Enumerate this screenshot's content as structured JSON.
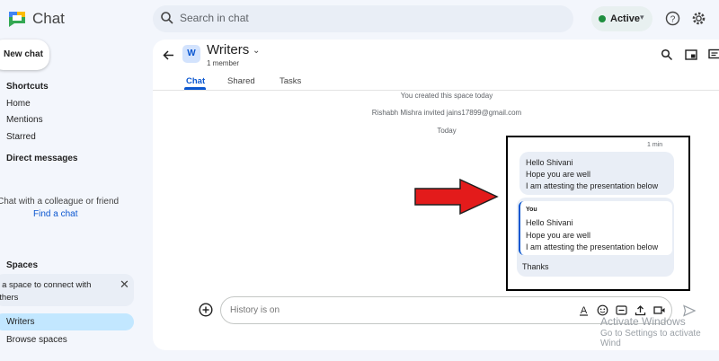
{
  "app": {
    "title": "Chat"
  },
  "search": {
    "placeholder": "Search in chat"
  },
  "status": {
    "label": "Active"
  },
  "sidebar": {
    "new_chat": "New chat",
    "shortcuts_header": "Shortcuts",
    "shortcuts": [
      "Home",
      "Mentions",
      "Starred"
    ],
    "dm_header": "Direct messages",
    "dm_empty": "Chat with a colleague or friend",
    "dm_find": "Find a chat",
    "spaces_header": "Spaces",
    "spaces_promo": "Join a space to connect with others",
    "spaces": [
      "Writers",
      "Browse spaces"
    ]
  },
  "space": {
    "avatar_letter": "W",
    "name": "Writers",
    "members": "1 member",
    "tabs": [
      "Chat",
      "Shared",
      "Tasks"
    ]
  },
  "system_messages": [
    "You created this space today",
    "Rishabh Mishra invited jains17899@gmail.com",
    "Today"
  ],
  "messages": {
    "time": "1 min",
    "first": [
      "Hello Shivani",
      "Hope you are well",
      "I am attesting the presentation below"
    ],
    "quote_author": "You",
    "quoted": [
      "Hello Shivani",
      "Hope you are well",
      "I am attesting the presentation below"
    ],
    "reply": "Thanks"
  },
  "composer": {
    "placeholder": "History is on"
  },
  "watermark": {
    "line1": "Activate Windows",
    "line2": "Go to Settings to activate Wind"
  },
  "colors": {
    "accent": "#0b57d0",
    "active_green": "#1e8e3e",
    "arrow_red": "#e31b1b"
  }
}
